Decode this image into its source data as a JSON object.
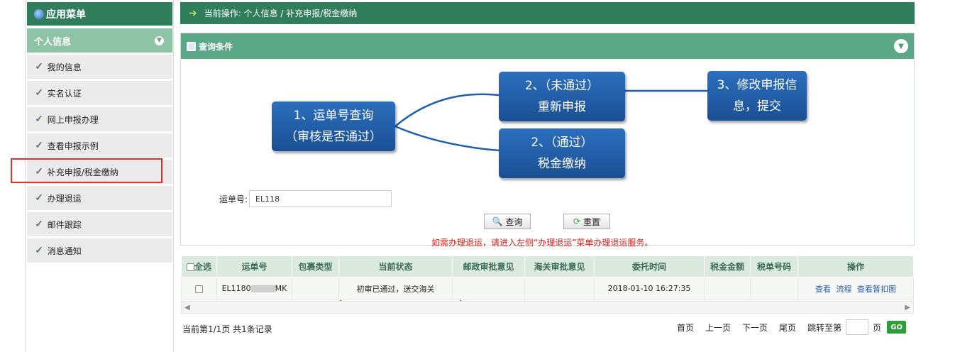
{
  "sidebar": {
    "header": "应用菜单",
    "section": "个人信息",
    "items": [
      "我的信息",
      "实名认证",
      "网上申报办理",
      "查看申报示例",
      "补充申报/税金缴纳",
      "办理退运",
      "邮件跟踪",
      "消息通知"
    ]
  },
  "topbar": {
    "label": "当前操作: 个人信息 / 补充申报/税金缴纳"
  },
  "panel": {
    "title": "查询条件",
    "flow": {
      "n1_line1": "1、运单号查询",
      "n1_line2": "（审核是否通过）",
      "n2a_line1": "2、（未通过）",
      "n2a_line2": "重新申报",
      "n2b_line1": "2、（通过）",
      "n2b_line2": "税金缴纳",
      "n3_line1": "3、修改申报信",
      "n3_line2": "息，提交"
    },
    "waybill_label": "运单号:",
    "waybill_value": "EL118",
    "query_btn": "查询",
    "reset_btn": "重置",
    "notice": "如需办理退运，请进入左侧“办理退运”菜单办理退运服务。"
  },
  "table": {
    "headers": [
      "全选",
      "运单号",
      "包裹类型",
      "当前状态",
      "邮政审批意见",
      "海关审批意见",
      "委托时间",
      "税金金额",
      "税单号码",
      "操作"
    ],
    "row": {
      "waybill": "EL1180",
      "waybill_suffix": "MK",
      "status": "初审已通过，送交海关",
      "time": "2018-01-10 16:27:35",
      "actions": [
        "查看",
        "流程",
        "查看暂扣图"
      ]
    }
  },
  "pager": {
    "summary": "当前第1/1页 共1条记录",
    "first": "首页",
    "prev": "上一页",
    "next": "下一页",
    "last": "尾页",
    "jump": "跳转至第",
    "page_unit": "页",
    "go": "GO"
  },
  "colors": {
    "primary": "#2f7d5b",
    "highlight": "#e0302b",
    "node": "#2c6fbd"
  }
}
